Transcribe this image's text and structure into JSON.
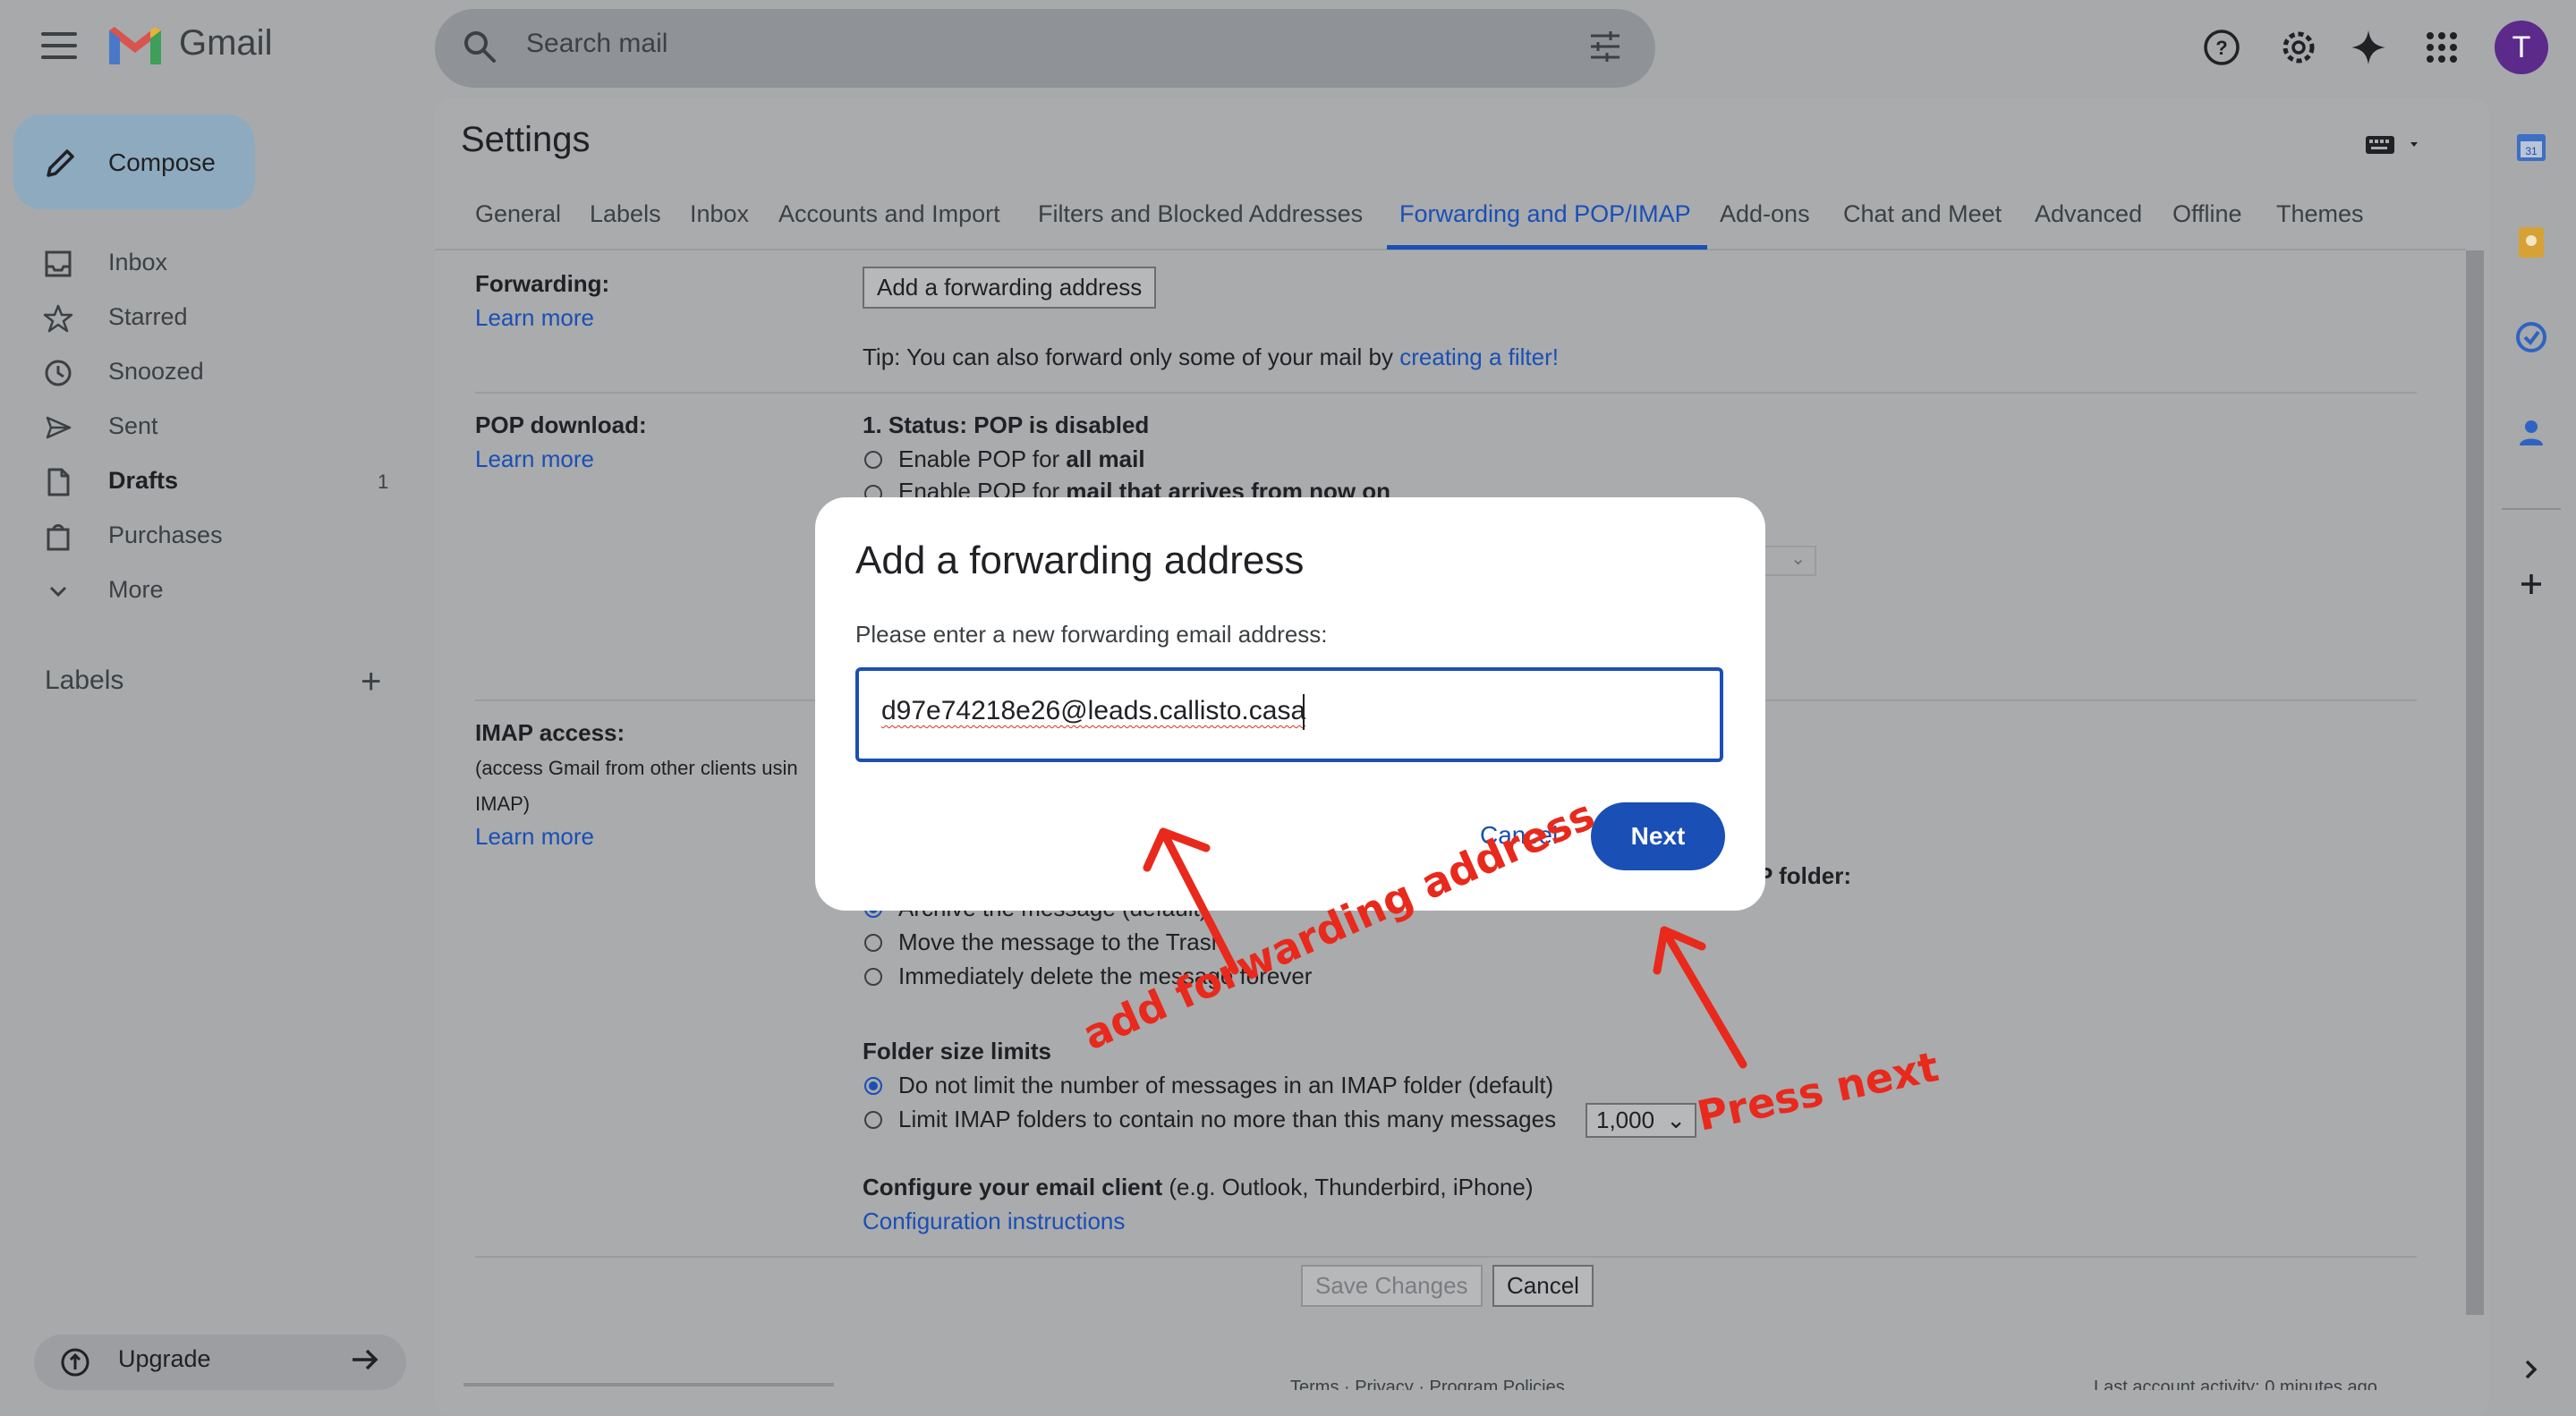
{
  "app": {
    "name": "Gmail",
    "avatar_letter": "T"
  },
  "search": {
    "placeholder": "Search mail"
  },
  "sidebar": {
    "compose": "Compose",
    "items": [
      {
        "label": "Inbox",
        "icon": "inbox-icon"
      },
      {
        "label": "Starred",
        "icon": "star-icon"
      },
      {
        "label": "Snoozed",
        "icon": "clock-icon"
      },
      {
        "label": "Sent",
        "icon": "send-icon"
      },
      {
        "label": "Drafts",
        "icon": "draft-icon",
        "count": "1"
      },
      {
        "label": "Purchases",
        "icon": "bag-icon"
      },
      {
        "label": "More",
        "icon": "chevron-down-icon"
      }
    ],
    "labels_heading": "Labels",
    "upgrade": "Upgrade"
  },
  "settings": {
    "title": "Settings",
    "tabs": [
      "General",
      "Labels",
      "Inbox",
      "Accounts and Import",
      "Filters and Blocked Addresses",
      "Forwarding and POP/IMAP",
      "Add-ons",
      "Chat and Meet",
      "Advanced",
      "Offline",
      "Themes"
    ],
    "active_tab": "Forwarding and POP/IMAP",
    "forwarding": {
      "heading": "Forwarding:",
      "learn_more": "Learn more",
      "add_button": "Add a forwarding address",
      "tip_prefix": "Tip: You can also forward only some of your mail by ",
      "tip_link": "creating a filter!"
    },
    "pop": {
      "heading": "POP download:",
      "learn_more": "Learn more",
      "status": "1. Status: POP is disabled",
      "opt1_prefix": "Enable POP for ",
      "opt1_bold": "all mail",
      "opt2_prefix": "Enable POP for ",
      "opt2_bold": "mail that arrives from now on"
    },
    "imap": {
      "heading": "IMAP access:",
      "desc1": "(access Gmail from other clients usin",
      "desc2": "IMAP)",
      "learn_more": "Learn more",
      "folder_label_tail": "P folder:",
      "opt_archive": "Archive the message (default)",
      "opt_trash": "Move the message to the Trash",
      "opt_delete": "Immediately delete the message forever",
      "folder_size_heading": "Folder size limits",
      "size_opt1": "Do not limit the number of messages in an IMAP folder (default)",
      "size_opt2": "Limit IMAP folders to contain no more than this many messages",
      "size_value": "1,000",
      "configure_bold": "Configure your email client",
      "configure_rest": " (e.g. Outlook, Thunderbird, iPhone)",
      "config_link": "Configuration instructions"
    },
    "save_button": "Save Changes",
    "cancel_button": "Cancel",
    "footer_left": "Terms · Privacy · Program Policies",
    "footer_right": "Last account activity: 0 minutes ago"
  },
  "dialog": {
    "title": "Add a forwarding address",
    "prompt": "Please enter a new forwarding email address:",
    "email_value": "d97e74218e26@leads.callisto.casa",
    "cancel": "Cancel",
    "next": "Next"
  },
  "annotations": {
    "left": "add forwarding address",
    "right": "Press next",
    "color": "#e8291c"
  },
  "colors": {
    "accent": "#1a4fb5",
    "avatar": "#5b2a8a"
  }
}
